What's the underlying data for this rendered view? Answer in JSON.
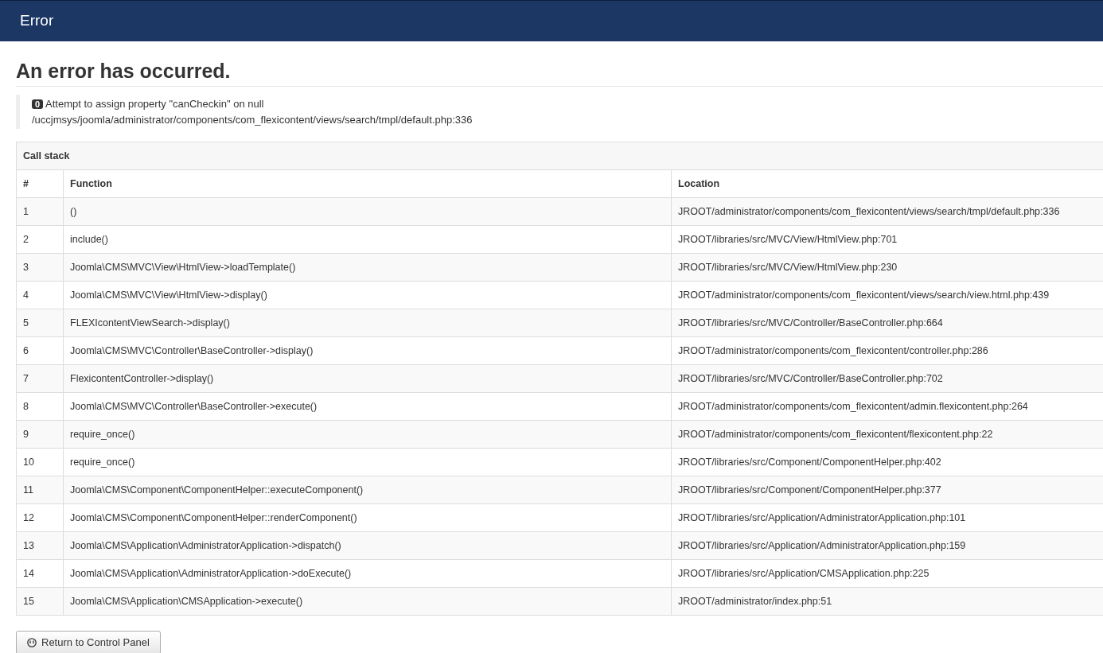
{
  "header": {
    "title": "Error"
  },
  "heading": "An error has occurred.",
  "error": {
    "code": "0",
    "message": "Attempt to assign property \"canCheckin\" on null",
    "file": "/uccjmsys/joomla/administrator/components/com_flexicontent/views/search/tmpl/default.php:336"
  },
  "call_stack": {
    "title": "Call stack",
    "columns": [
      "#",
      "Function",
      "Location"
    ],
    "rows": [
      [
        "1",
        "()",
        "JROOT/administrator/components/com_flexicontent/views/search/tmpl/default.php:336"
      ],
      [
        "2",
        "include()",
        "JROOT/libraries/src/MVC/View/HtmlView.php:701"
      ],
      [
        "3",
        "Joomla\\CMS\\MVC\\View\\HtmlView->loadTemplate()",
        "JROOT/libraries/src/MVC/View/HtmlView.php:230"
      ],
      [
        "4",
        "Joomla\\CMS\\MVC\\View\\HtmlView->display()",
        "JROOT/administrator/components/com_flexicontent/views/search/view.html.php:439"
      ],
      [
        "5",
        "FLEXIcontentViewSearch->display()",
        "JROOT/libraries/src/MVC/Controller/BaseController.php:664"
      ],
      [
        "6",
        "Joomla\\CMS\\MVC\\Controller\\BaseController->display()",
        "JROOT/administrator/components/com_flexicontent/controller.php:286"
      ],
      [
        "7",
        "FlexicontentController->display()",
        "JROOT/libraries/src/MVC/Controller/BaseController.php:702"
      ],
      [
        "8",
        "Joomla\\CMS\\MVC\\Controller\\BaseController->execute()",
        "JROOT/administrator/components/com_flexicontent/admin.flexicontent.php:264"
      ],
      [
        "9",
        "require_once()",
        "JROOT/administrator/components/com_flexicontent/flexicontent.php:22"
      ],
      [
        "10",
        "require_once()",
        "JROOT/libraries/src/Component/ComponentHelper.php:402"
      ],
      [
        "11",
        "Joomla\\CMS\\Component\\ComponentHelper::executeComponent()",
        "JROOT/libraries/src/Component/ComponentHelper.php:377"
      ],
      [
        "12",
        "Joomla\\CMS\\Component\\ComponentHelper::renderComponent()",
        "JROOT/libraries/src/Application/AdministratorApplication.php:101"
      ],
      [
        "13",
        "Joomla\\CMS\\Application\\AdministratorApplication->dispatch()",
        "JROOT/libraries/src/Application/AdministratorApplication.php:159"
      ],
      [
        "14",
        "Joomla\\CMS\\Application\\AdministratorApplication->doExecute()",
        "JROOT/libraries/src/Application/CMSApplication.php:225"
      ],
      [
        "15",
        "Joomla\\CMS\\Application\\CMSApplication->execute()",
        "JROOT/administrator/index.php:51"
      ]
    ]
  },
  "button": {
    "label": "Return to Control Panel"
  }
}
